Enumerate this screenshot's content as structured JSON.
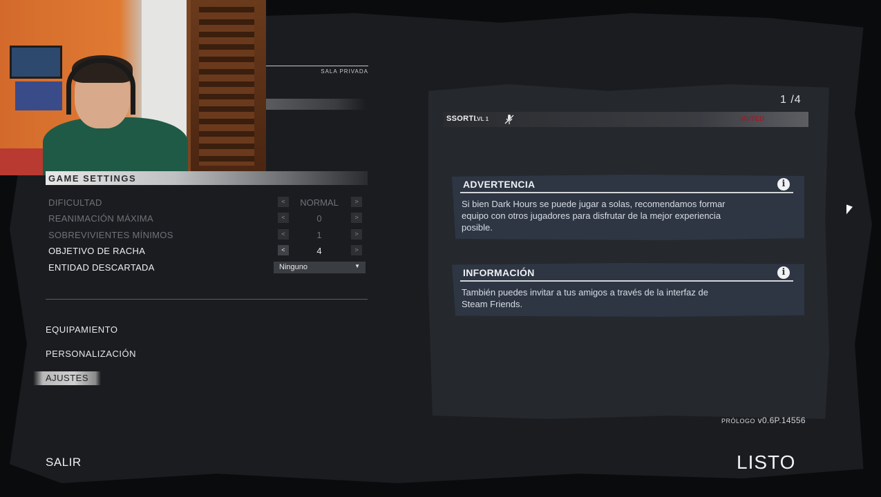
{
  "lobby": {
    "room_type": "SALA PRIVADA",
    "player_count": "1 /4"
  },
  "game_settings": {
    "title": "GAME SETTINGS",
    "rows": [
      {
        "label": "DIFICULTAD",
        "value": "NORMAL"
      },
      {
        "label": "REANIMACIÓN MÁXIMA",
        "value": "0"
      },
      {
        "label": "SOBREVIVIENTES MÍNIMOS",
        "value": "1"
      },
      {
        "label": "OBJETIVO DE RACHA",
        "value": "4"
      },
      {
        "label": "ENTIDAD DESCARTADA",
        "value": "Ninguno"
      }
    ],
    "arrow_left": "<",
    "arrow_right": ">"
  },
  "menu": {
    "equipment": "EQUIPAMIENTO",
    "customization": "PERSONALIZACIÓN",
    "settings": "AJUSTES"
  },
  "player": {
    "name": "SSORTI",
    "level": "LVL 1",
    "status": "MUTED"
  },
  "notices": [
    {
      "title": "ADVERTENCIA",
      "text": "Si bien Dark Hours se puede jugar a solas, recomendamos formar equipo con otros jugadores para disfrutar de la mejor experiencia posible."
    },
    {
      "title": "INFORMACIÓN",
      "text": "También puedes invitar a tus amigos a través de la interfaz de Steam Friends."
    }
  ],
  "footer": {
    "version_prefix": "PRÓLOGO",
    "version": "v0.6P.14556",
    "exit": "SALIR",
    "ready": "LISTO"
  },
  "colors": {
    "background": "#1a1c20",
    "panel": "#25282d",
    "notice_bg": "#2e3644",
    "muted_red": "#9b1c2a"
  }
}
